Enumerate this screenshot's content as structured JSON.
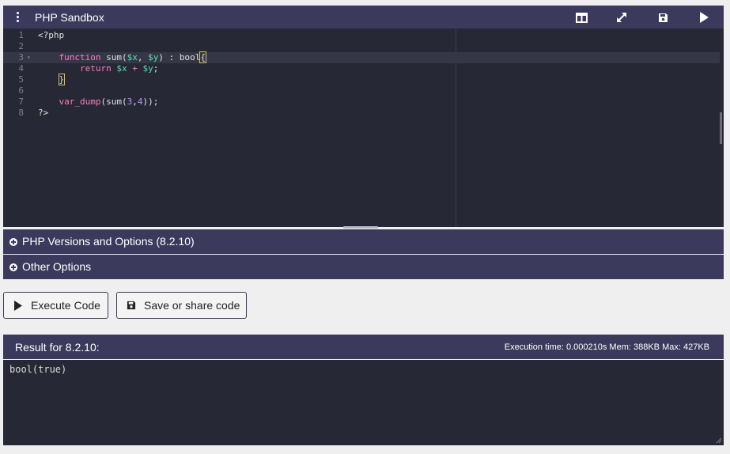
{
  "header": {
    "title": "PHP Sandbox",
    "icons": [
      "menu-dots-icon",
      "split-view-icon",
      "fullscreen-icon",
      "save-icon",
      "play-icon"
    ]
  },
  "editor": {
    "line_numbers": [
      "1",
      "2",
      "3",
      "4",
      "5",
      "6",
      "7",
      "8"
    ],
    "active_line": 3,
    "lines": [
      "<?php",
      "",
      "    function sum($x, $y) : bool{",
      "        return $x + $y;",
      "    }",
      "",
      "    var_dump(sum(3,4));",
      "?>"
    ]
  },
  "sections": {
    "php_versions": "PHP Versions and Options (8.2.10)",
    "other_options": "Other Options"
  },
  "buttons": {
    "execute": "Execute Code",
    "save_share": "Save or share code"
  },
  "result": {
    "label": "Result for 8.2.10:",
    "stats": "Execution time: 0.000210s Mem: 388KB Max: 427KB",
    "output": "bool(true)"
  },
  "colors": {
    "bar": "#3b3a5c",
    "editor_bg": "#272835",
    "keyword": "#ff79c6",
    "variable": "#50e3a4",
    "number": "#bd93f9"
  }
}
